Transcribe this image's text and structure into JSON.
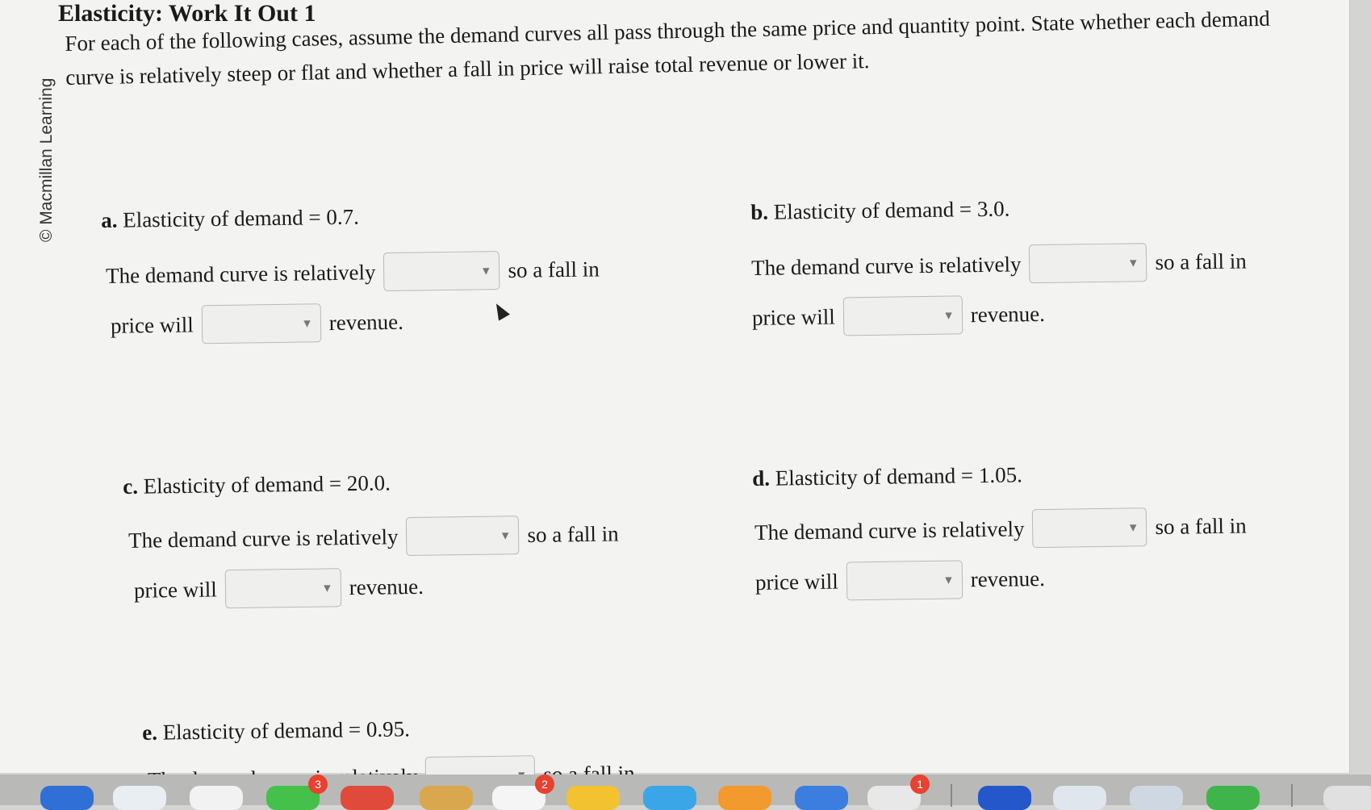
{
  "title": "Elasticity: Work It Out 1",
  "watermark": "© Macmillan Learning",
  "instructions": "For each of the following cases, assume the demand curves all pass through the same price and quantity point. State whether each demand curve is relatively steep or flat and whether a fall in price will raise total revenue or lower it.",
  "sentence": {
    "prefix": "The demand curve is relatively",
    "middle": "so a fall in",
    "price_will": "price will",
    "suffix": "revenue."
  },
  "parts": [
    {
      "letter": "a.",
      "text": "Elasticity of demand = 0.7.",
      "curve_value": "",
      "revenue_value": ""
    },
    {
      "letter": "b.",
      "text": "Elasticity of demand = 3.0.",
      "curve_value": "",
      "revenue_value": ""
    },
    {
      "letter": "c.",
      "text": "Elasticity of demand = 20.0.",
      "curve_value": "",
      "revenue_value": ""
    },
    {
      "letter": "d.",
      "text": "Elasticity of demand = 1.05.",
      "curve_value": "",
      "revenue_value": ""
    },
    {
      "letter": "e.",
      "text": "Elasticity of demand = 0.95.",
      "curve_value": "",
      "revenue_value": ""
    }
  ],
  "dock": {
    "badges": [
      "3",
      "2",
      "1"
    ]
  },
  "colors": {
    "page": "#f3f3f1",
    "badge": "#e8412f"
  }
}
